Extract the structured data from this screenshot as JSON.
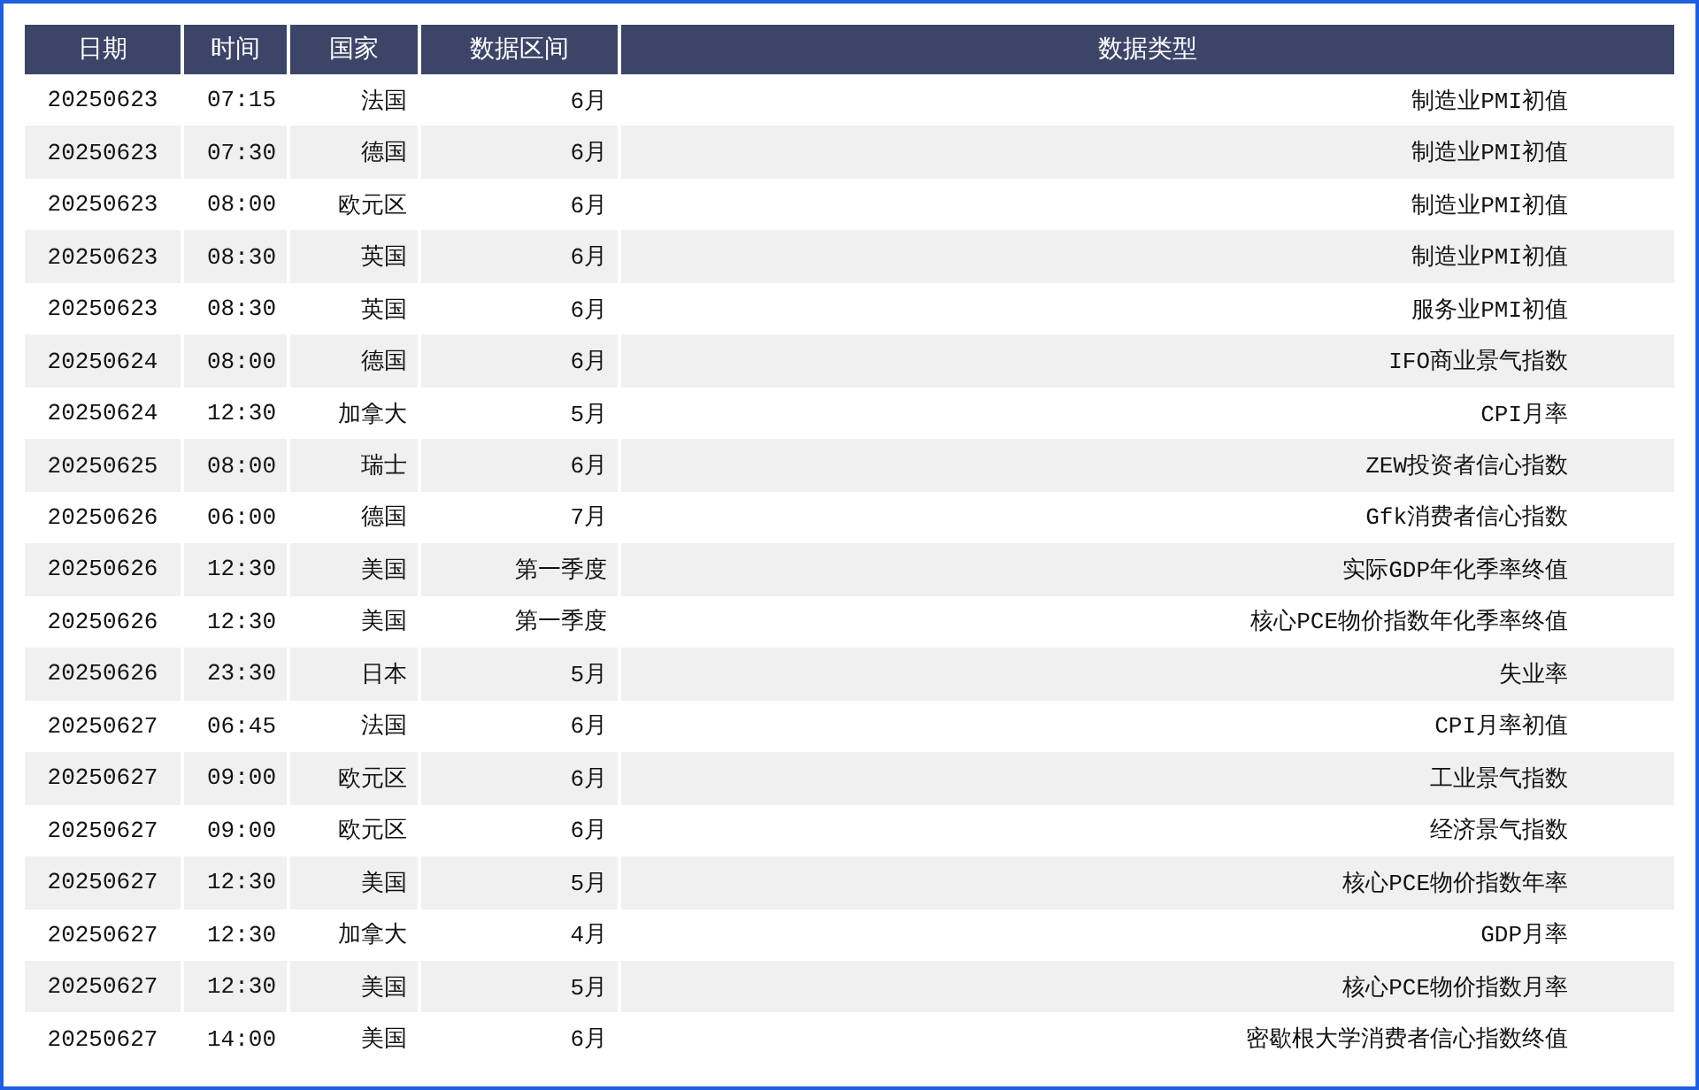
{
  "table": {
    "columns": [
      "日期",
      "时间",
      "国家",
      "数据区间",
      "数据类型"
    ],
    "rows": [
      [
        "20250623",
        "07:15",
        "法国",
        "6月",
        "制造业PMI初值"
      ],
      [
        "20250623",
        "07:30",
        "德国",
        "6月",
        "制造业PMI初值"
      ],
      [
        "20250623",
        "08:00",
        "欧元区",
        "6月",
        "制造业PMI初值"
      ],
      [
        "20250623",
        "08:30",
        "英国",
        "6月",
        "制造业PMI初值"
      ],
      [
        "20250623",
        "08:30",
        "英国",
        "6月",
        "服务业PMI初值"
      ],
      [
        "20250624",
        "08:00",
        "德国",
        "6月",
        "IFO商业景气指数"
      ],
      [
        "20250624",
        "12:30",
        "加拿大",
        "5月",
        "CPI月率"
      ],
      [
        "20250625",
        "08:00",
        "瑞士",
        "6月",
        "ZEW投资者信心指数"
      ],
      [
        "20250626",
        "06:00",
        "德国",
        "7月",
        "Gfk消费者信心指数"
      ],
      [
        "20250626",
        "12:30",
        "美国",
        "第一季度",
        "实际GDP年化季率终值"
      ],
      [
        "20250626",
        "12:30",
        "美国",
        "第一季度",
        "核心PCE物价指数年化季率终值"
      ],
      [
        "20250626",
        "23:30",
        "日本",
        "5月",
        "失业率"
      ],
      [
        "20250627",
        "06:45",
        "法国",
        "6月",
        "CPI月率初值"
      ],
      [
        "20250627",
        "09:00",
        "欧元区",
        "6月",
        "工业景气指数"
      ],
      [
        "20250627",
        "09:00",
        "欧元区",
        "6月",
        "经济景气指数"
      ],
      [
        "20250627",
        "12:30",
        "美国",
        "5月",
        "核心PCE物价指数年率"
      ],
      [
        "20250627",
        "12:30",
        "加拿大",
        "4月",
        "GDP月率"
      ],
      [
        "20250627",
        "12:30",
        "美国",
        "5月",
        "核心PCE物价指数月率"
      ],
      [
        "20250627",
        "14:00",
        "美国",
        "6月",
        "密歇根大学消费者信心指数终值"
      ]
    ]
  }
}
